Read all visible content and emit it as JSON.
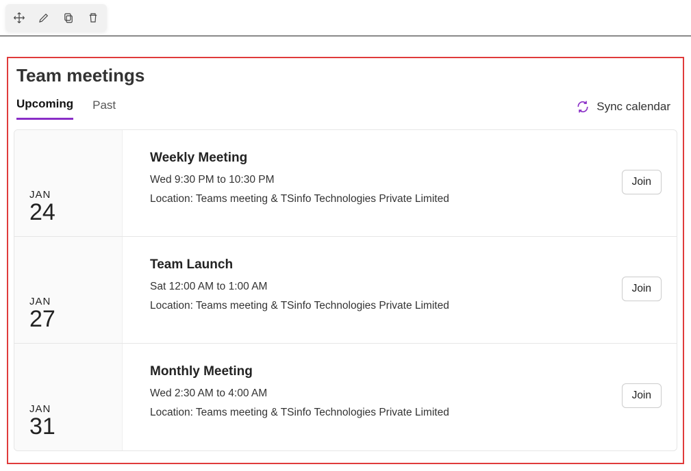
{
  "toolbar": {
    "icons": [
      "move-icon",
      "edit-icon",
      "copy-icon",
      "delete-icon"
    ]
  },
  "card": {
    "title": "Team meetings",
    "tabs": [
      {
        "label": "Upcoming",
        "active": true
      },
      {
        "label": "Past",
        "active": false
      }
    ],
    "sync_label": "Sync calendar"
  },
  "meetings": [
    {
      "month": "JAN",
      "day": "24",
      "title": "Weekly Meeting",
      "time": "Wed 9:30 PM to 10:30 PM",
      "location": "Location: Teams meeting & TSinfo Technologies Private Limited",
      "join_label": "Join"
    },
    {
      "month": "JAN",
      "day": "27",
      "title": "Team Launch",
      "time": "Sat 12:00 AM to 1:00 AM",
      "location": "Location: Teams meeting & TSinfo Technologies Private Limited",
      "join_label": "Join"
    },
    {
      "month": "JAN",
      "day": "31",
      "title": "Monthly Meeting",
      "time": "Wed 2:30 AM to 4:00 AM",
      "location": "Location: Teams meeting & TSinfo Technologies Private Limited",
      "join_label": "Join"
    }
  ]
}
